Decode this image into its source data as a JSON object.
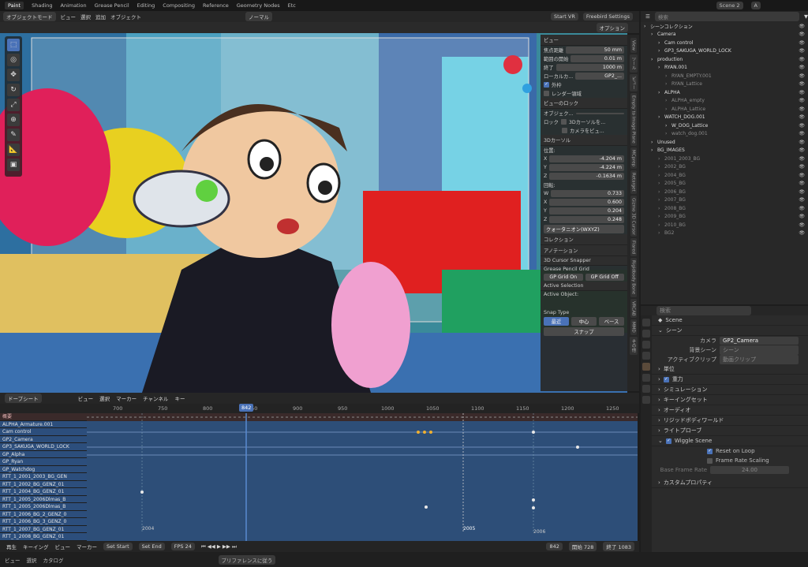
{
  "topbar": {
    "tabs": [
      "Paint",
      "Shading",
      "Animation",
      "Grease Pencil",
      "Editing",
      "Compositing",
      "Reference",
      "Geometry Nodes",
      "Etc"
    ],
    "active_tab": "Paint",
    "scene": "Scene",
    "scene_count": "2",
    "view_layer": "A"
  },
  "viewport_header": {
    "mode": "オブジェクトモード",
    "menus": [
      "ビュー",
      "選択",
      "追加",
      "オブジェクト"
    ],
    "shading_mode": "ノーマル",
    "start_vr": "Start VR",
    "freebird": "Freebird Settings",
    "options": "オプション"
  },
  "npanel": {
    "view_header": "ビュー",
    "focal_label": "焦点距離",
    "focal_value": "50 mm",
    "clip_start_label": "範囲の開始",
    "clip_start_value": "0.01 m",
    "clip_end_label": "終了",
    "clip_end_value": "1000 m",
    "local_camera_label": "ローカルカ...",
    "local_camera_value": "GP2_...",
    "lock_label": "外枠",
    "render_region": "レンダー領域",
    "view_lock_header": "ビューのロック",
    "object_label": "オブジェク...",
    "lock2_label": "ロック",
    "lock_cursor": "3Dカーソルを...",
    "lock_camera": "カメラをビュ...",
    "cursor_header": "3Dカーソル",
    "location_label": "位置:",
    "loc_x": "-4.204 m",
    "loc_y": "-4.224 m",
    "loc_z": "-0.1634 m",
    "rotation_label": "回転:",
    "rot_w": "0.733",
    "rot_x": "0.600",
    "rot_y": "0.204",
    "rot_z": "0.248",
    "rot_mode": "クォータニオン(WXYZ)",
    "collection": "コレクション",
    "annotation": "アノテーション",
    "snapper": "3D Cursor Snapper",
    "gp_grid": "Grease Pencil Grid",
    "gp_grid_on": "GP Grid On",
    "gp_grid_off": "GP Grid Off",
    "active_selection": "Active Selection",
    "active_object": "Active Object:",
    "snap_type": "Snap Type",
    "snap_closest": "最近",
    "snap_center": "中心",
    "snap_base": "ベース",
    "snap": "スナップ"
  },
  "vtabs": [
    "View",
    "ツール",
    "ビュー",
    "Empty to Image Plane",
    "MCprep",
    "Retarget",
    "Gizmo 3D Cursor",
    "Flared",
    "Rigidbody Bone",
    "VRCAB",
    "MMD",
    "その他"
  ],
  "dopesheet": {
    "editor": "ドープシート",
    "menus": [
      "ビュー",
      "選択",
      "マーカー",
      "チャンネル",
      "キー"
    ],
    "frames": [
      "700",
      "750",
      "800",
      "850",
      "900",
      "950",
      "1000",
      "1050",
      "1100",
      "1150",
      "1200",
      "1250"
    ],
    "current_frame": "842",
    "summary": "概要",
    "channels": [
      "ALPHA_Armature.001",
      "Cam control",
      "GP2_Camera",
      "GP3_SAKUGA_WORLD_LOCK",
      "GP_Alpha",
      "GP_Ryan",
      "GP_Watchdog",
      "RTT_1_2001_2003_BG_GEN",
      "RTT_1_2002_BG_GENZ_01",
      "RTT_1_2004_BG_GENZ_01",
      "RTT_1_2005_2006Dlmas_B",
      "RTT_1_2005_2006Dlmas_B",
      "RTT_1_2006_BG_2_GENZ_0",
      "RTT_1_2006_BG_3_GENZ_0",
      "RTT_1_2007_BG_GENZ_01",
      "RTT_1_2008_BG_GENZ_01"
    ],
    "markers": [
      "2004",
      "2005",
      "2006"
    ]
  },
  "timeline": {
    "playback": "再生",
    "keying": "キーイング",
    "view": "ビュー",
    "marker": "マーカー",
    "set_start": "Set Start",
    "set_end": "Set End",
    "fps_label": "FPS",
    "fps": "24",
    "frame": "842",
    "start_label": "開始",
    "start": "728",
    "end_label": "終了",
    "end": "1083"
  },
  "statusbar": {
    "items": [
      "ビュー",
      "選択",
      "カタログ"
    ],
    "pref": "プリファレンスに従う"
  },
  "outliner": {
    "search_placeholder": "検索",
    "items": [
      {
        "label": "シーンコレクション",
        "indent": 0,
        "dim": false
      },
      {
        "label": "Camera",
        "indent": 1,
        "dim": false
      },
      {
        "label": "Cam control",
        "indent": 2,
        "dim": false
      },
      {
        "label": "GP3_SAKUGA_WORLD_LOCK",
        "indent": 2,
        "dim": false
      },
      {
        "label": "production",
        "indent": 1,
        "dim": false
      },
      {
        "label": "RYAN.001",
        "indent": 2,
        "dim": false
      },
      {
        "label": "RYAN_EMPTY.001",
        "indent": 3,
        "dim": true
      },
      {
        "label": "RYAN_Lattice",
        "indent": 3,
        "dim": true
      },
      {
        "label": "ALPHA",
        "indent": 2,
        "dim": false
      },
      {
        "label": "ALPHA_empty",
        "indent": 3,
        "dim": true
      },
      {
        "label": "ALPHA_Lattice",
        "indent": 3,
        "dim": true
      },
      {
        "label": "WATCH_DOG.001",
        "indent": 2,
        "dim": false
      },
      {
        "label": "W_DOG_Lattice",
        "indent": 3,
        "dim": false
      },
      {
        "label": "watch_dog.001",
        "indent": 3,
        "dim": true
      },
      {
        "label": "Unused",
        "indent": 1,
        "dim": false
      },
      {
        "label": "BG_IMAGES",
        "indent": 1,
        "dim": false
      },
      {
        "label": "2001_2003_BG",
        "indent": 2,
        "dim": true
      },
      {
        "label": "2002_BG",
        "indent": 2,
        "dim": true
      },
      {
        "label": "2004_BG",
        "indent": 2,
        "dim": true
      },
      {
        "label": "2005_BG",
        "indent": 2,
        "dim": true
      },
      {
        "label": "2006_BG",
        "indent": 2,
        "dim": true
      },
      {
        "label": "2007_BG",
        "indent": 2,
        "dim": true
      },
      {
        "label": "2008_BG",
        "indent": 2,
        "dim": true
      },
      {
        "label": "2009_BG",
        "indent": 2,
        "dim": true
      },
      {
        "label": "2010_BG",
        "indent": 2,
        "dim": true
      },
      {
        "label": "BG2",
        "indent": 2,
        "dim": true
      }
    ]
  },
  "properties": {
    "search_placeholder": "検索",
    "scene_name": "Scene",
    "scene_section": "シーン",
    "camera_label": "カメラ",
    "camera_value": "GP2_Camera",
    "bg_scene_label": "背景シーン",
    "bg_scene_value": "シーン",
    "active_clip_label": "アクティブクリップ",
    "active_clip_value": "動画クリップ",
    "sections": [
      "単位",
      "重力",
      "シミュレーション",
      "キーイングセット",
      "オーディオ",
      "リジッドボディワールド",
      "ライトプローブ"
    ],
    "wiggle": "Wiggle Scene",
    "reset_on_loop": "Reset on Loop",
    "frame_rate_scaling": "Frame Rate Scaling",
    "base_frame_rate_label": "Base Frame Rate",
    "base_frame_rate": "24.00",
    "custom_props": "カスタムプロパティ"
  },
  "colors": {
    "accent": "#4a72b8",
    "playhead": "#5a8ad0",
    "keyframe": "#e8e8e8",
    "selected_key": "#f0b030"
  }
}
